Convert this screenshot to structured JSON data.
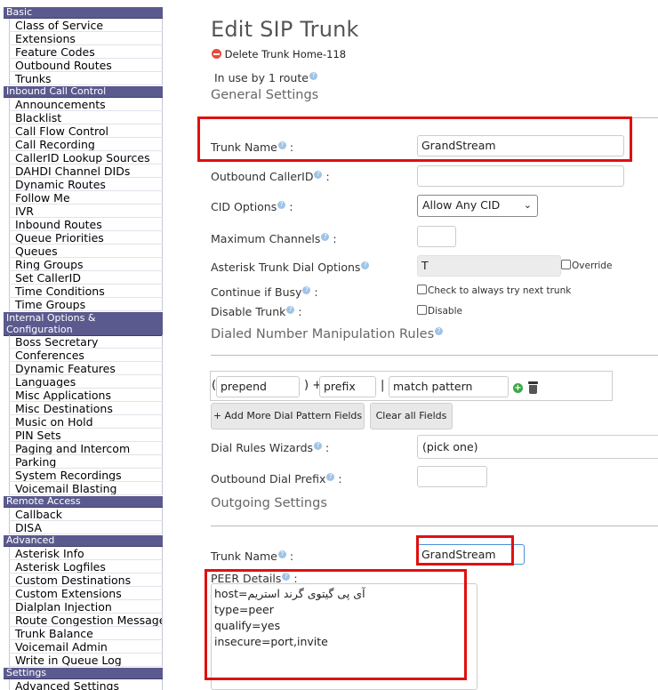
{
  "sidebar": {
    "sections": [
      {
        "title": "Basic",
        "items": [
          "Class of Service",
          "Extensions",
          "Feature Codes",
          "Outbound Routes",
          "Trunks"
        ]
      },
      {
        "title": "Inbound Call Control",
        "items": [
          "Announcements",
          "Blacklist",
          "Call Flow Control",
          "Call Recording",
          "CallerID Lookup Sources",
          "DAHDI Channel DIDs",
          "Dynamic Routes",
          "Follow Me",
          "IVR",
          "Inbound Routes",
          "Queue Priorities",
          "Queues",
          "Ring Groups",
          "Set CallerID",
          "Time Conditions",
          "Time Groups"
        ]
      },
      {
        "title_line1": "Internal Options &",
        "title_line2": "Configuration",
        "items": [
          "Boss Secretary",
          "Conferences",
          "Dynamic Features",
          "Languages",
          "Misc Applications",
          "Misc Destinations",
          "Music on Hold",
          "PIN Sets",
          "Paging and Intercom",
          "Parking",
          "System Recordings",
          "Voicemail Blasting"
        ]
      },
      {
        "title": "Remote Access",
        "items": [
          "Callback",
          "DISA"
        ]
      },
      {
        "title": "Advanced",
        "items": [
          "Asterisk Info",
          "Asterisk Logfiles",
          "Custom Destinations",
          "Custom Extensions",
          "Dialplan Injection",
          "Route Congestion Messages",
          "Trunk Balance",
          "Voicemail Admin",
          "Write in Queue Log"
        ]
      },
      {
        "title": "Settings",
        "items": [
          "Advanced Settings"
        ]
      }
    ]
  },
  "main": {
    "title": "Edit SIP Trunk",
    "delete_link": "Delete Trunk Home-118",
    "in_use": "In use by 1 route",
    "general_settings": "General Settings",
    "trunk_name_label": "Trunk Name",
    "trunk_name_value": "GrandStream",
    "outbound_callerid_label": "Outbound CallerID",
    "outbound_callerid_value": "",
    "cid_options_label": "CID Options",
    "cid_options_value": "Allow Any CID",
    "max_channels_label": "Maximum Channels",
    "max_channels_value": "",
    "dial_options_label": "Asterisk Trunk Dial Options",
    "dial_options_value": "T",
    "override_label": "Override",
    "continue_busy_label": "Continue if Busy",
    "continue_busy_check": "Check to always try next trunk",
    "disable_trunk_label": "Disable Trunk",
    "disable_check": "Disable",
    "dialed_rules_title": "Dialed Number Manipulation Rules",
    "prepend_placeholder": "prepend",
    "prefix_placeholder": "prefix",
    "match_placeholder": "match pattern",
    "add_more_button": "+ Add More Dial Pattern Fields",
    "clear_all_button": "Clear all Fields",
    "dial_wizards_label": "Dial Rules Wizards",
    "dial_wizards_value": "(pick one)",
    "outbound_prefix_label": "Outbound Dial Prefix",
    "outbound_prefix_value": "",
    "outgoing_settings": "Outgoing Settings",
    "out_trunk_name_label": "Trunk Name",
    "out_trunk_name_value": "GrandStream",
    "peer_details_label": "PEER Details",
    "peer_lines": [
      "host=آی پی گیتوی گرند استریم",
      "type=peer",
      "qualify=yes",
      "insecure=port,invite"
    ],
    "colon": ":"
  },
  "colors": {
    "sidebar_header": "#5a5a8e",
    "highlight": "#e01010",
    "focus": "#4a90d9"
  }
}
